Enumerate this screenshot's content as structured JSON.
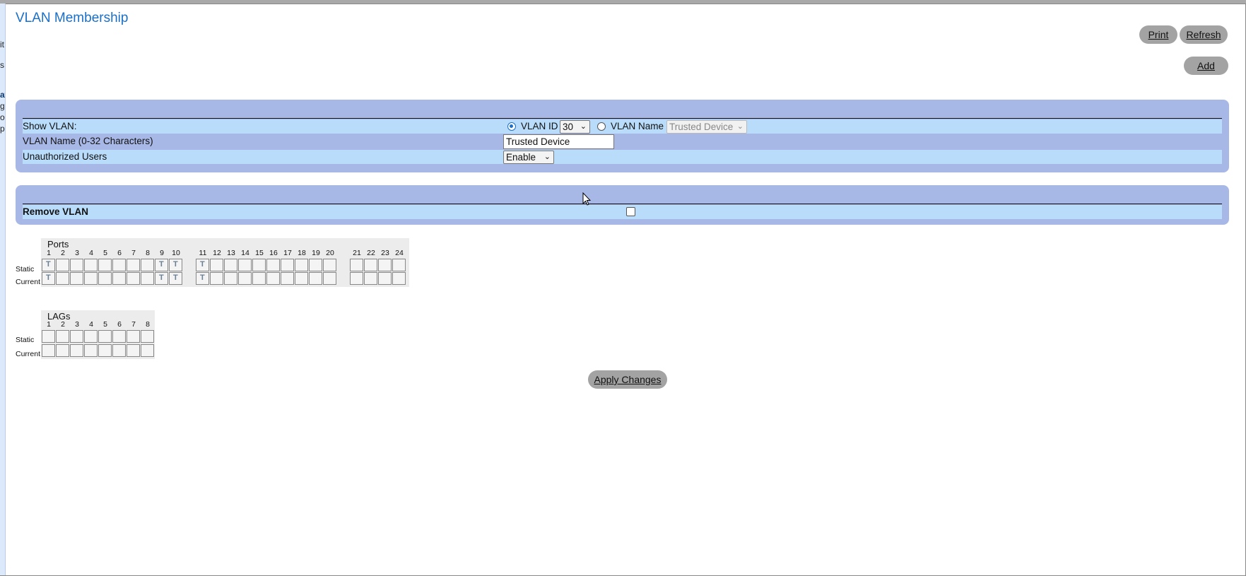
{
  "page": {
    "title": "VLAN Membership",
    "buttons": {
      "print": "Print",
      "refresh": "Refresh",
      "add": "Add"
    },
    "left_nav_fragments": [
      "it",
      "s",
      "at",
      "gs",
      "or",
      "po"
    ]
  },
  "settings": {
    "show_vlan_label": "Show VLAN:",
    "vlan_id_radio_label": "VLAN ID",
    "vlan_id_value": "30",
    "vlan_name_radio_label": "VLAN Name",
    "vlan_name_select_value": "Trusted Device",
    "vlan_name_field_label": "VLAN Name (0-32 Characters)",
    "vlan_name_field_value": "Trusted Device",
    "unauthorized_users_label": "Unauthorized Users",
    "unauthorized_users_value": "Enable"
  },
  "remove": {
    "label": "Remove VLAN"
  },
  "ports": {
    "title": "Ports",
    "row_static": "Static",
    "row_current": "Current",
    "numbers": [
      "1",
      "2",
      "3",
      "4",
      "5",
      "6",
      "7",
      "8",
      "9",
      "10",
      "11",
      "12",
      "13",
      "14",
      "15",
      "16",
      "17",
      "18",
      "19",
      "20",
      "21",
      "22",
      "23",
      "24"
    ],
    "static": [
      "T",
      "",
      "",
      "",
      "",
      "",
      "",
      "",
      "T",
      "T",
      "T",
      "",
      "",
      "",
      "",
      "",
      "",
      "",
      "",
      "",
      "",
      "",
      "",
      ""
    ],
    "current": [
      "T",
      "",
      "",
      "",
      "",
      "",
      "",
      "",
      "T",
      "T",
      "T",
      "",
      "",
      "",
      "",
      "",
      "",
      "",
      "",
      "",
      "",
      "",
      "",
      ""
    ]
  },
  "lags": {
    "title": "LAGs",
    "row_static": "Static",
    "row_current": "Current",
    "numbers": [
      "1",
      "2",
      "3",
      "4",
      "5",
      "6",
      "7",
      "8"
    ],
    "static": [
      "",
      "",
      "",
      "",
      "",
      "",
      "",
      ""
    ],
    "current": [
      "",
      "",
      "",
      "",
      "",
      "",
      "",
      ""
    ]
  },
  "apply_label": "Apply Changes"
}
